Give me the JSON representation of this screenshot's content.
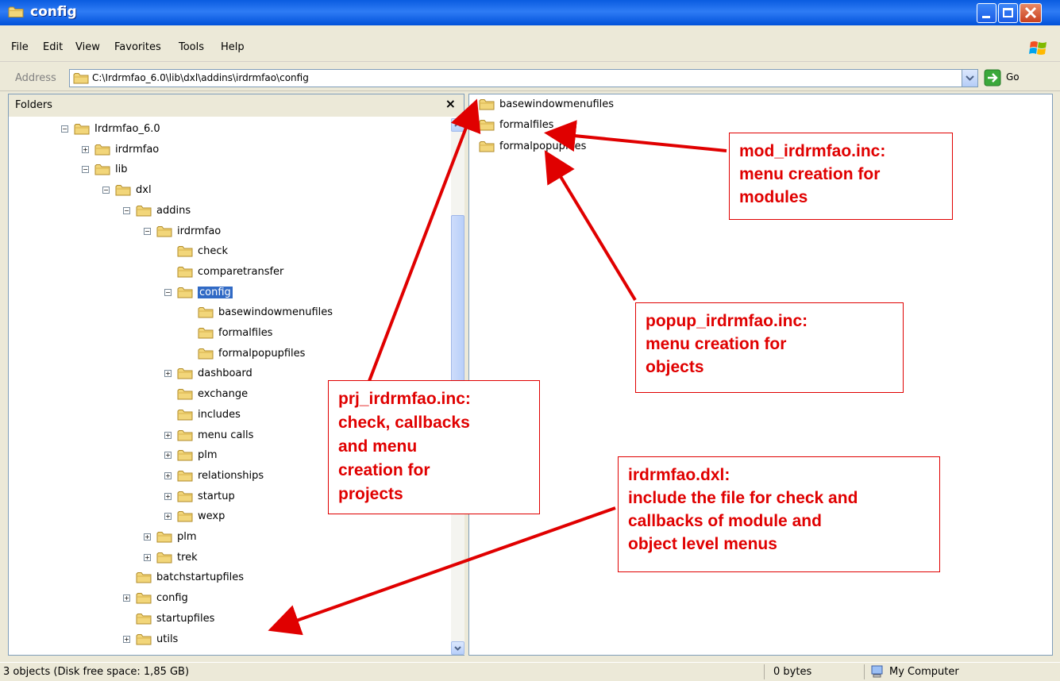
{
  "window": {
    "title": "config"
  },
  "menubar": {
    "items": [
      "File",
      "Edit",
      "View",
      "Favorites",
      "Tools",
      "Help"
    ]
  },
  "address": {
    "label": "Address",
    "path": "C:\\Irdrmfao_6.0\\lib\\dxl\\addins\\irdrmfao\\config",
    "go_label": "Go"
  },
  "folders_pane": {
    "title": "Folders",
    "close_glyph": "×",
    "tree": [
      {
        "label": "Irdrmfao_6.0",
        "expander": "⊟"
      },
      {
        "label": "irdrmfao",
        "expander": "⊞"
      },
      {
        "label": "lib",
        "expander": "⊟"
      },
      {
        "label": "dxl",
        "expander": "⊟"
      },
      {
        "label": "addins",
        "expander": "⊟"
      },
      {
        "label": "irdrmfao",
        "expander": "⊟"
      },
      {
        "label": "check",
        "expander": ""
      },
      {
        "label": "comparetransfer",
        "expander": ""
      },
      {
        "label": "config",
        "expander": "⊟",
        "selected": true
      },
      {
        "label": "basewindowmenufiles",
        "expander": ""
      },
      {
        "label": "formalfiles",
        "expander": ""
      },
      {
        "label": "formalpopupfiles",
        "expander": ""
      },
      {
        "label": "dashboard",
        "expander": "⊞"
      },
      {
        "label": "exchange",
        "expander": ""
      },
      {
        "label": "includes",
        "expander": ""
      },
      {
        "label": "menu calls",
        "expander": "⊞"
      },
      {
        "label": "plm",
        "expander": "⊞"
      },
      {
        "label": "relationships",
        "expander": "⊞"
      },
      {
        "label": "startup",
        "expander": "⊞"
      },
      {
        "label": "wexp",
        "expander": "⊞"
      },
      {
        "label": "plm",
        "expander": "⊞"
      },
      {
        "label": "trek",
        "expander": "⊞"
      },
      {
        "label": "batchstartupfiles",
        "expander": ""
      },
      {
        "label": "config",
        "expander": "⊞"
      },
      {
        "label": "startupfiles",
        "expander": ""
      },
      {
        "label": "utils",
        "expander": "⊞"
      }
    ]
  },
  "content_pane": {
    "items": [
      "basewindowmenufiles",
      "formalfiles",
      "formalpopupfiles"
    ]
  },
  "statusbar": {
    "objects": "3 objects (Disk free space: 1,85 GB)",
    "size": "0 bytes",
    "location": "My Computer"
  },
  "annotations": [
    {
      "lines": [
        "mod_irdrmfao.inc:",
        "menu creation for",
        "modules"
      ]
    },
    {
      "lines": [
        "popup_irdrmfao.inc:",
        "menu creation for",
        "objects"
      ]
    },
    {
      "lines": [
        "prj_irdrmfao.inc:",
        "check, callbacks",
        "and menu",
        "creation for",
        "projects"
      ]
    },
    {
      "lines": [
        "irdrmfao.dxl:",
        "include the file for check and",
        "callbacks of module and",
        "object level menus"
      ]
    }
  ],
  "colors": {
    "annotation": "#e00000",
    "titlebar": "#0a5ce0",
    "selection": "#316ac5",
    "folder": "#f2d67a"
  }
}
